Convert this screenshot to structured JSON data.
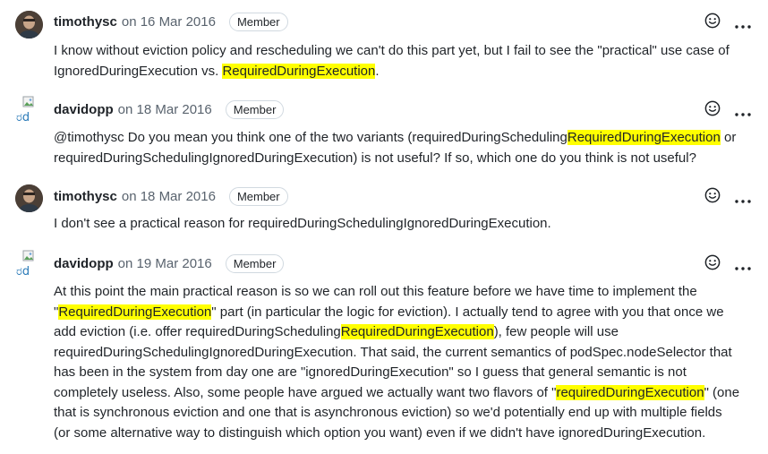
{
  "comments": [
    {
      "author": "timothysc",
      "date": "on 16 Mar 2016",
      "badge": "Member",
      "avatar_type": "photo",
      "lines": [
        [
          {
            "t": "I know without eviction policy and rescheduling we can't do this part yet, but I fail to see the \"practical\" use case of"
          }
        ],
        [
          {
            "t": "IgnoredDuringExecution vs. "
          },
          {
            "t": "RequiredDuringExecution",
            "hl": true
          },
          {
            "t": "."
          }
        ]
      ]
    },
    {
      "author": "davidopp",
      "date": "on 18 Mar 2016",
      "badge": "Member",
      "avatar_type": "broken",
      "lines": [
        [
          {
            "t": "@timothysc Do you mean you think one of the two variants (requiredDuringScheduling"
          },
          {
            "t": "RequiredDuringExecution",
            "hl": true
          },
          {
            "t": " or"
          }
        ],
        [
          {
            "t": "requiredDuringSchedulingIgnoredDuringExecution) is not useful? If so, which one do you think is not useful?"
          }
        ]
      ]
    },
    {
      "author": "timothysc",
      "date": "on 18 Mar 2016",
      "badge": "Member",
      "avatar_type": "photo",
      "lines": [
        [
          {
            "t": "I don't see a practical reason for requiredDuringSchedulingIgnoredDuringExecution."
          }
        ]
      ]
    },
    {
      "author": "davidopp",
      "date": "on 19 Mar 2016",
      "badge": "Member",
      "avatar_type": "broken",
      "lines": [
        [
          {
            "t": "At this point the main practical reason is so we can roll out this feature before we have time to implement the"
          }
        ],
        [
          {
            "t": "\""
          },
          {
            "t": "RequiredDuringExecution",
            "hl": true
          },
          {
            "t": "\" part (in particular the logic for eviction). I actually tend to agree with you that once we"
          }
        ],
        [
          {
            "t": "add eviction (i.e. offer requiredDuringScheduling"
          },
          {
            "t": "RequiredDuringExecution",
            "hl": true
          },
          {
            "t": "), few people will use"
          }
        ],
        [
          {
            "t": "requiredDuringSchedulingIgnoredDuringExecution. That said, the current semantics of podSpec.nodeSelector that"
          }
        ],
        [
          {
            "t": "has been in the system from day one are \"ignoredDuringExecution\" so I guess that general semantic is not"
          }
        ],
        [
          {
            "t": "completely useless. Also, some people have argued we actually want two flavors of \""
          },
          {
            "t": "requiredDuringExecution",
            "hl": true
          },
          {
            "t": "\" (one"
          }
        ],
        [
          {
            "t": "that is synchronous eviction and one that is asynchronous eviction) so we'd potentially end up with multiple fields"
          }
        ],
        [
          {
            "t": "(or some alternative way to distinguish which option you want) even if we didn't have ignoredDuringExecution."
          }
        ]
      ]
    }
  ],
  "icons": {
    "reaction": "smiley-icon",
    "more": "kebab-horizontal-icon"
  },
  "colors": {
    "highlight": "#ffff00",
    "muted": "#59636e",
    "text": "#1f2328",
    "border": "#d1d9e0"
  }
}
